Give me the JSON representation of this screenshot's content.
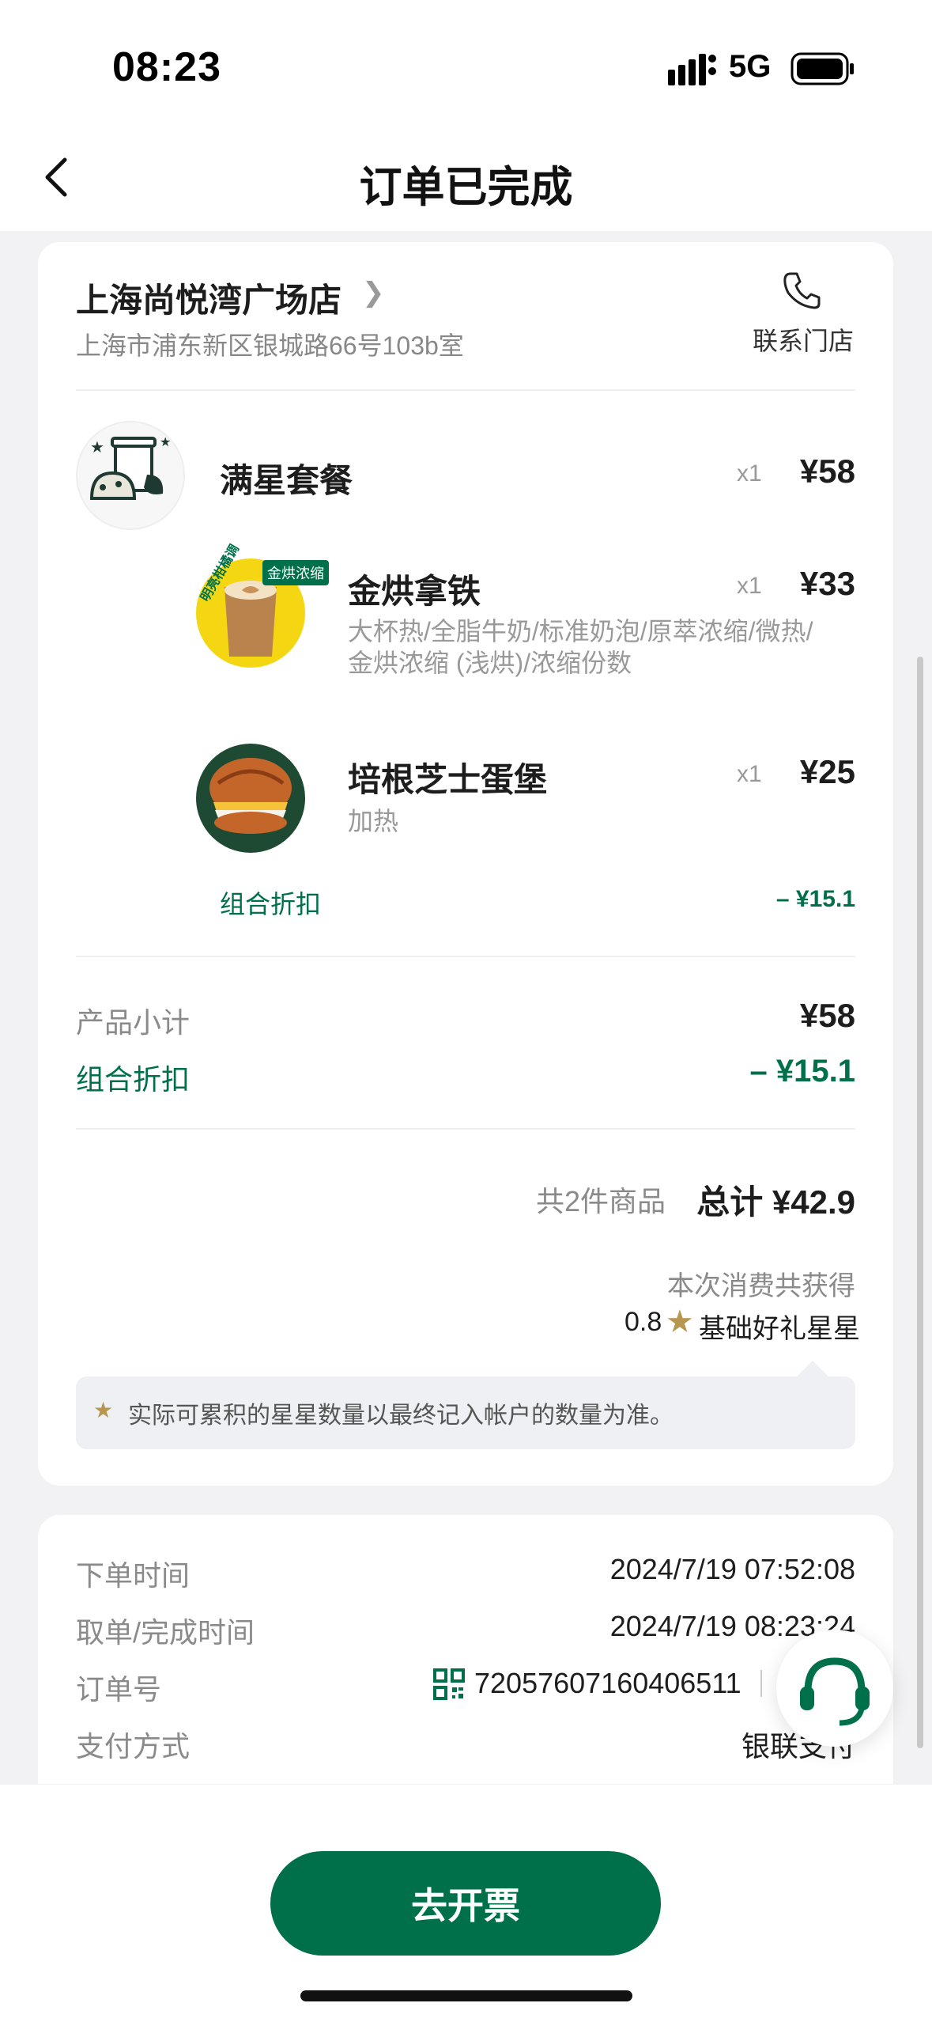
{
  "status_bar": {
    "time": "08:23",
    "network": "5G"
  },
  "header": {
    "title": "订单已完成"
  },
  "store": {
    "name": "上海尚悦湾广场店",
    "address": "上海市浦东新区银城路66号103b室",
    "contact_label": "联系门店"
  },
  "items": [
    {
      "name": "满星套餐",
      "qty": "x1",
      "price": "¥58"
    },
    {
      "name": "金烘拿铁",
      "qty": "x1",
      "price": "¥33",
      "options": "大杯热/全脂牛奶/标准奶泡/原萃浓缩/微热/金烘浓缩 (浅烘)/浓缩份数",
      "badge": "金烘浓缩",
      "side_label": "明亮柑橘调"
    },
    {
      "name": "培根芝士蛋堡",
      "qty": "x1",
      "price": "¥25",
      "options": "加热"
    }
  ],
  "combo_discount": {
    "label": "组合折扣",
    "value": "– ¥15.1"
  },
  "summary": {
    "subtotal_label": "产品小计",
    "subtotal_value": "¥58",
    "discount_label": "组合折扣",
    "discount_value": "– ¥15.1",
    "count_text": "共2件商品",
    "total_text": "总计 ¥42.9",
    "earn_text": "本次消费共获得",
    "stars_value": "0.8",
    "stars_label": "基础好礼星星",
    "note": "实际可累积的星星数量以最终记入帐户的数量为准。"
  },
  "order_info": {
    "order_time_label": "下单时间",
    "order_time_value": "2024/7/19 07:52:08",
    "pickup_label": "取单/完成时间",
    "pickup_value": "2024/7/19 08:23:24",
    "order_no_label": "订单号",
    "order_no_value": "72057607160406511",
    "pay_label": "支付方式",
    "pay_value": "银联支付"
  },
  "buttons": {
    "invoice": "去开票"
  },
  "colors": {
    "brand_green": "#00704a",
    "star_gold": "#b79650"
  },
  "icons": [
    "back-icon",
    "chevron-right-icon",
    "phone-icon",
    "star-icon",
    "qr-code-icon",
    "headset-icon"
  ]
}
